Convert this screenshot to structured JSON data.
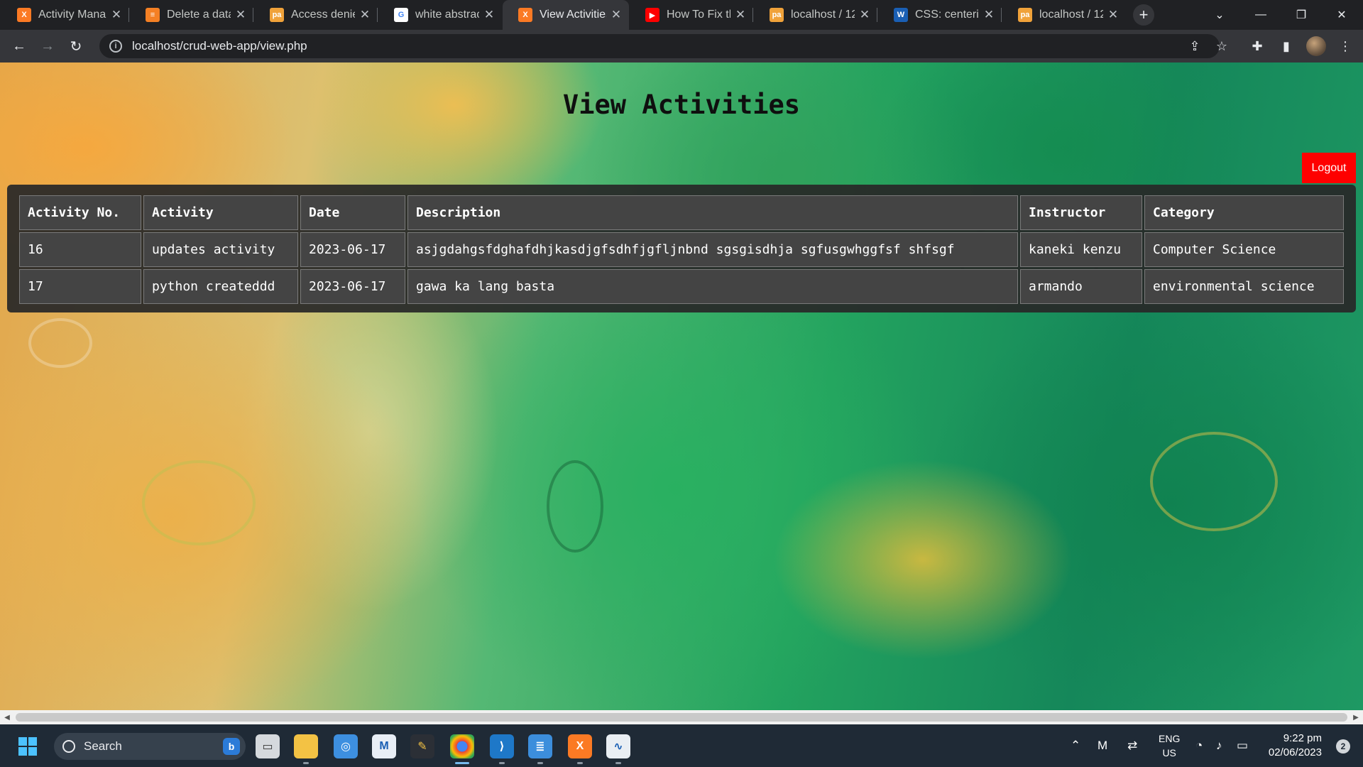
{
  "browser": {
    "tabs": [
      {
        "label": "Activity Mana",
        "favicon": "xampp-icon",
        "color": "#fb7a24"
      },
      {
        "label": "Delete a datal",
        "favicon": "stack-icon",
        "color": "#f48024"
      },
      {
        "label": "Access denied",
        "favicon": "phpmyadmin-icon",
        "color": "#f0a23a"
      },
      {
        "label": "white abstract",
        "favicon": "google-icon",
        "color": "#4285f4"
      },
      {
        "label": "View Activities",
        "favicon": "xampp-icon",
        "color": "#fb7a24"
      },
      {
        "label": "How To Fix the",
        "favicon": "youtube-icon",
        "color": "#ff0000"
      },
      {
        "label": "localhost / 12",
        "favicon": "phpmyadmin-icon",
        "color": "#f0a23a"
      },
      {
        "label": "CSS: centering",
        "favicon": "w3c-icon",
        "color": "#1a5fb4"
      },
      {
        "label": "localhost / 12",
        "favicon": "phpmyadmin-icon",
        "color": "#f0a23a"
      }
    ],
    "active_tab_index": 4,
    "url": "localhost/crud-web-app/view.php"
  },
  "page": {
    "title": "View Activities",
    "logout_label": "Logout",
    "table": {
      "headers": [
        "Activity No.",
        "Activity",
        "Date",
        "Description",
        "Instructor",
        "Category"
      ],
      "rows": [
        [
          "16",
          "updates activity",
          "2023-06-17",
          "asjgdahgsfdghafdhjkasdjgfsdhfjgfljnbnd sgsgisdhja sgfusgwhggfsf shfsgf",
          "kaneki kenzu",
          "Computer Science"
        ],
        [
          "17",
          "python createddd",
          "2023-06-17",
          "gawa ka lang basta",
          "armando",
          "environmental science"
        ]
      ]
    }
  },
  "taskbar": {
    "search_label": "Search",
    "lang_top": "ENG",
    "lang_bottom": "US",
    "time": "9:22 pm",
    "date": "02/06/2023",
    "notification_count": "2"
  }
}
